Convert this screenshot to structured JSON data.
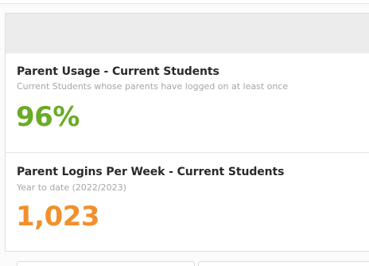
{
  "stats": [
    {
      "title": "Parent Usage - Current Students",
      "subtitle": "Current Students whose parents have logged on at least once",
      "value": "96%",
      "value_color": "#6aab26"
    },
    {
      "title": "Parent Logins Per Week - Current Students",
      "subtitle": "Year to date (2022/2023)",
      "value": "1,023",
      "value_color": "#f0902c"
    }
  ]
}
